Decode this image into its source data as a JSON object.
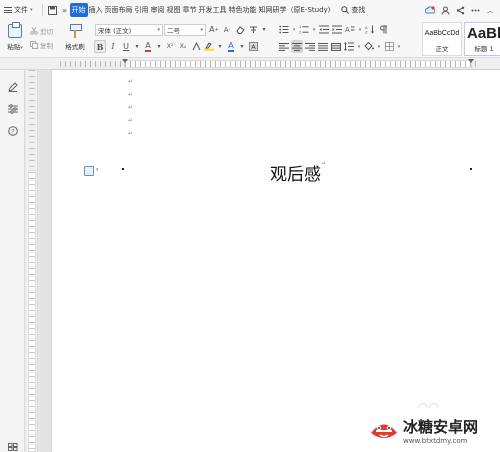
{
  "tabs": {
    "file": "文件",
    "more": "»",
    "items": [
      {
        "label": "开始",
        "active": true
      },
      {
        "label": "插入",
        "active": false
      },
      {
        "label": "页面布局",
        "active": false
      },
      {
        "label": "引用",
        "active": false
      },
      {
        "label": "审阅",
        "active": false
      },
      {
        "label": "视图",
        "active": false
      },
      {
        "label": "章节",
        "active": false
      },
      {
        "label": "开发工具",
        "active": false
      },
      {
        "label": "特色功能",
        "active": false
      },
      {
        "label": "知网研学（原E-Study)",
        "active": false
      }
    ],
    "search": "查找"
  },
  "clipboard": {
    "paste": "粘贴",
    "cut": "剪切",
    "copy": "复制",
    "format_painter": "格式刷"
  },
  "font": {
    "name": "宋体 (正文)",
    "size": "二号",
    "bold": "B",
    "italic": "I",
    "underline": "U",
    "color_a": "A",
    "grow": "A",
    "shrink": "A"
  },
  "styles": [
    {
      "preview": "AaBbCcDd",
      "caption": "正文"
    },
    {
      "preview": "AaBb",
      "caption": "标题 1"
    }
  ],
  "document": {
    "title": "观后感",
    "paragraph_mark": "↵"
  },
  "colors": {
    "accent": "#1f6fd6",
    "font_color": "#e23a2e",
    "highlight": "#f6e04c"
  },
  "watermark": {
    "name": "冰糖安卓网",
    "url": "www.btxtdmy.com"
  }
}
